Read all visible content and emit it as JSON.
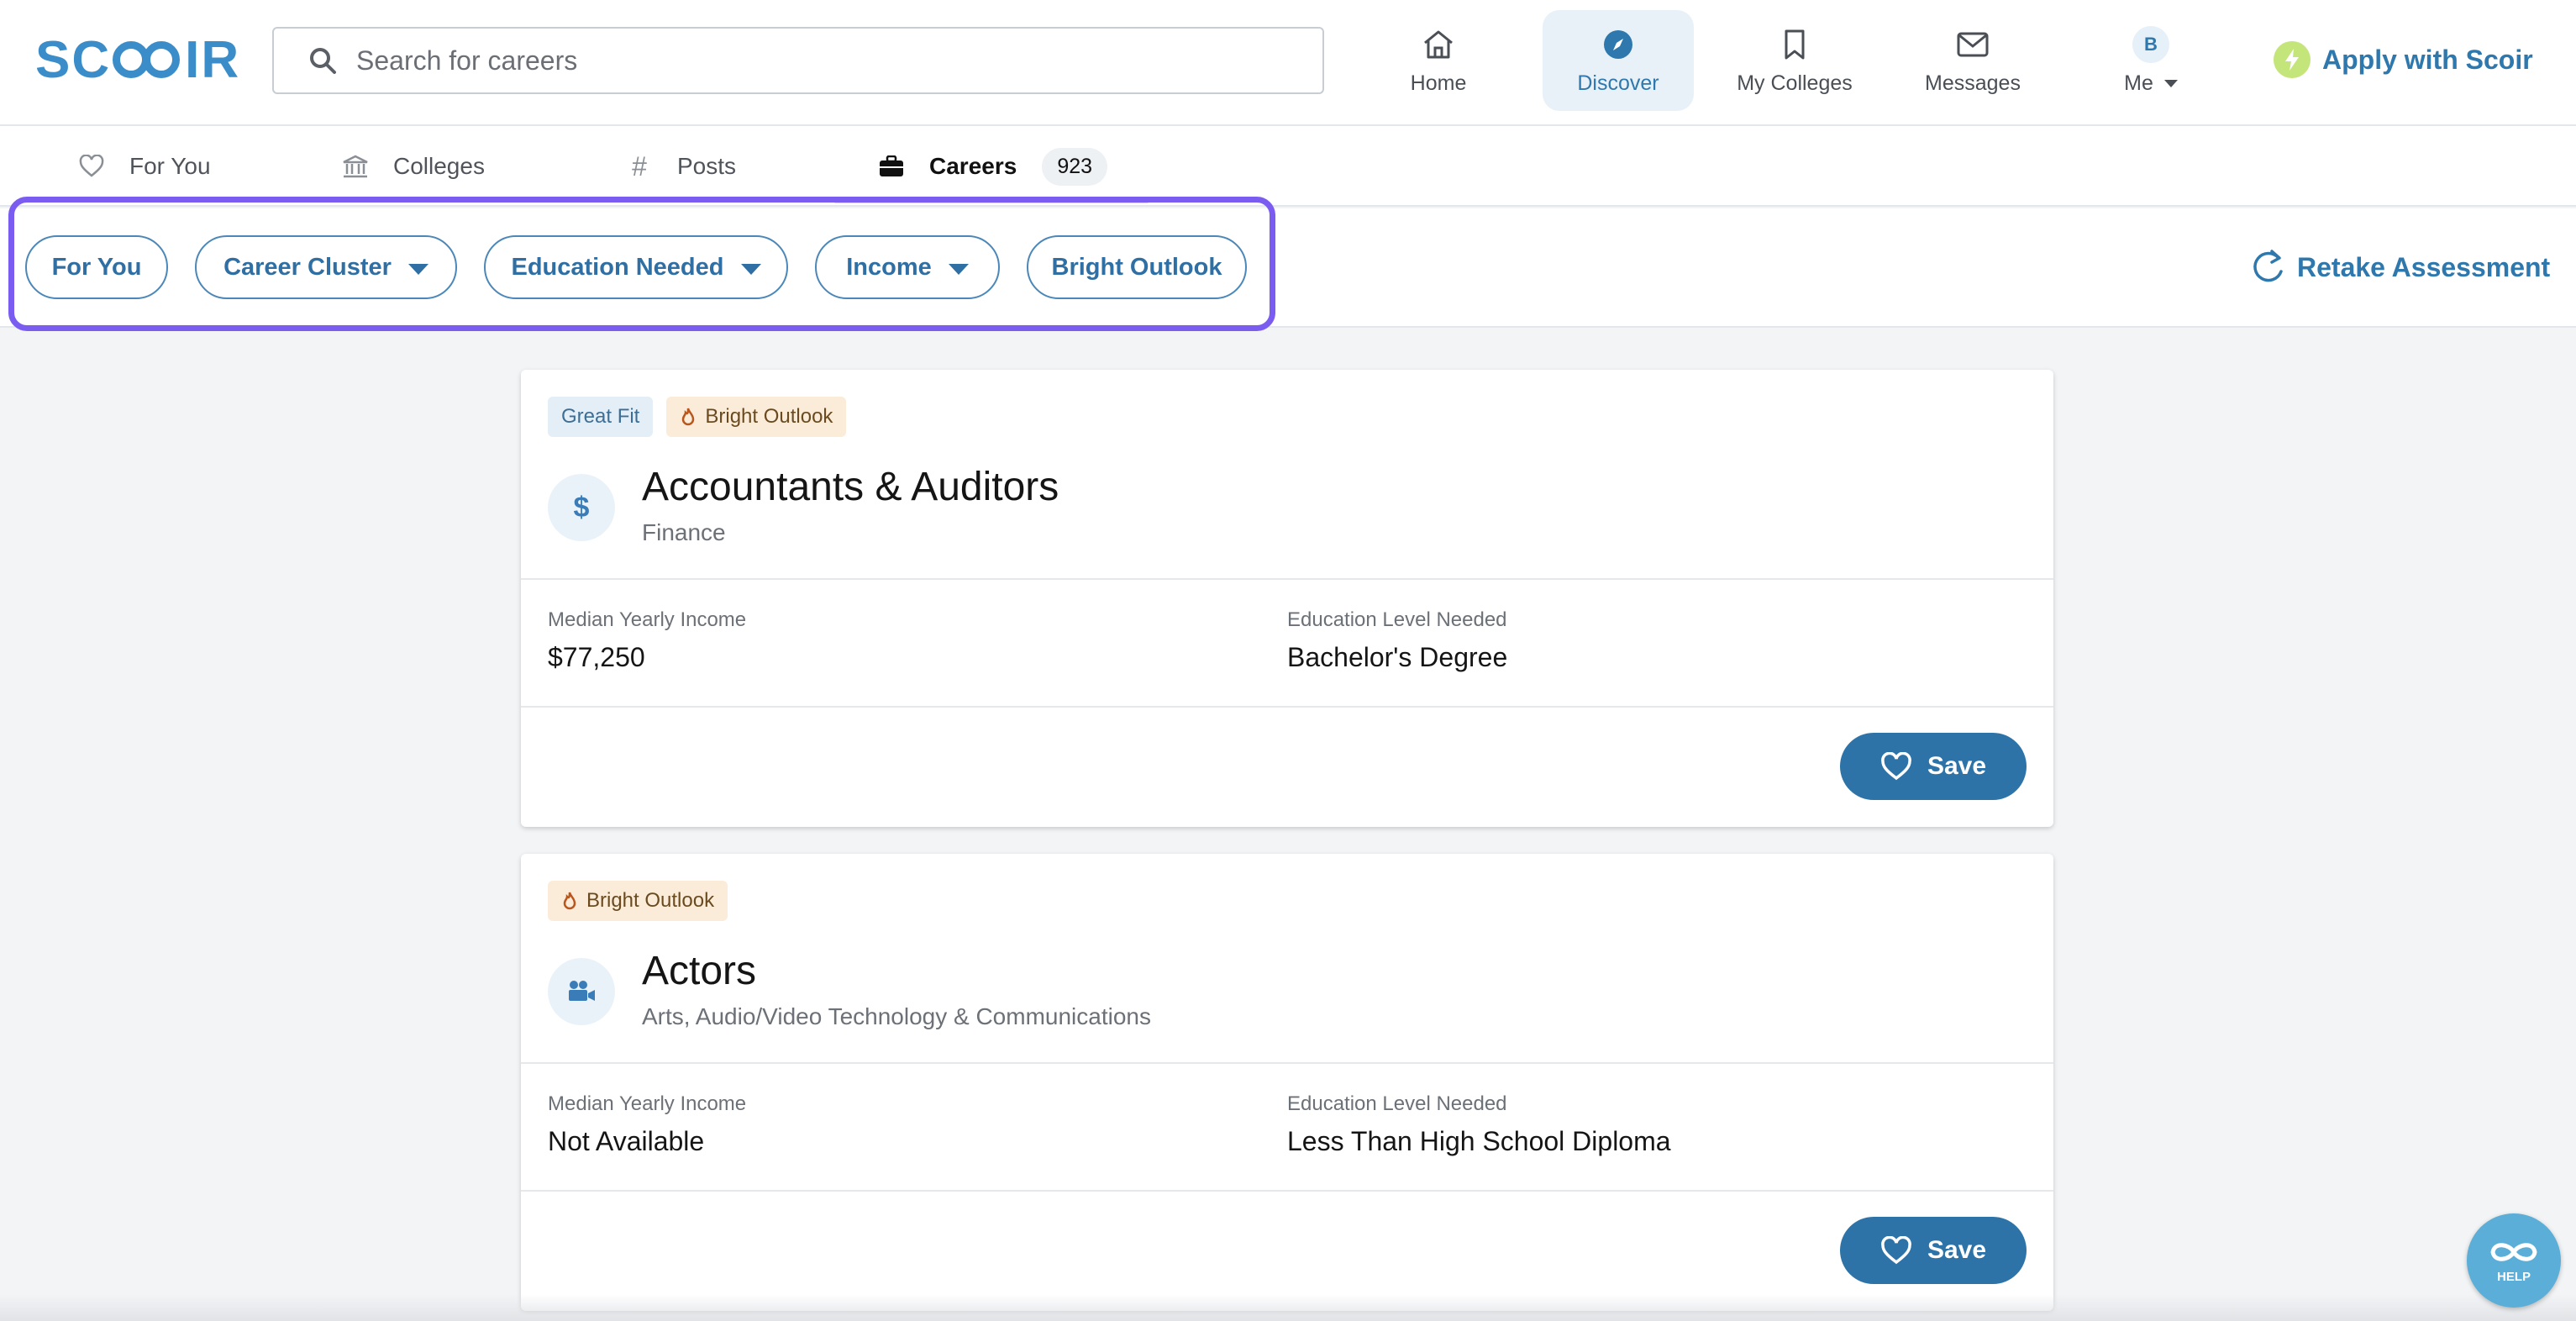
{
  "brand": {
    "logo_text_left": "SC",
    "logo_text_right": "IR"
  },
  "search": {
    "placeholder": "Search for careers"
  },
  "nav": {
    "home": "Home",
    "discover": "Discover",
    "my_colleges": "My Colleges",
    "messages": "Messages",
    "me": "Me",
    "avatar_initial": "B",
    "apply": "Apply with Scoir"
  },
  "tabs": [
    {
      "label": "For You",
      "icon": "heart-icon"
    },
    {
      "label": "Colleges",
      "icon": "bank-icon"
    },
    {
      "label": "Posts",
      "icon": "hash-icon"
    },
    {
      "label": "Careers",
      "icon": "briefcase-icon",
      "count": "923",
      "active": true
    }
  ],
  "filters": {
    "for_you": "For You",
    "career_cluster": "Career Cluster",
    "education_needed": "Education Needed",
    "income": "Income",
    "bright_outlook": "Bright Outlook",
    "retake": "Retake Assessment"
  },
  "careers": [
    {
      "badges": [
        "Great Fit",
        "Bright Outlook"
      ],
      "icon": "dollar-icon",
      "title": "Accountants & Auditors",
      "cluster": "Finance",
      "income_label": "Median Yearly Income",
      "income": "$77,250",
      "education_label": "Education Level Needed",
      "education": "Bachelor's Degree",
      "save": "Save"
    },
    {
      "badges": [
        "Bright Outlook"
      ],
      "icon": "video-camera-icon",
      "title": "Actors",
      "cluster": "Arts, Audio/Video Technology & Communications",
      "income_label": "Median Yearly Income",
      "income": "Not Available",
      "education_label": "Education Level Needed",
      "education": "Less Than High School Diploma",
      "save": "Save"
    }
  ],
  "help": {
    "label": "HELP"
  },
  "colors": {
    "brand_blue": "#3a8dc9",
    "button_blue": "#2d73a8",
    "highlight_purple": "#7b5cf0",
    "bolt_green": "#c4e57a"
  }
}
